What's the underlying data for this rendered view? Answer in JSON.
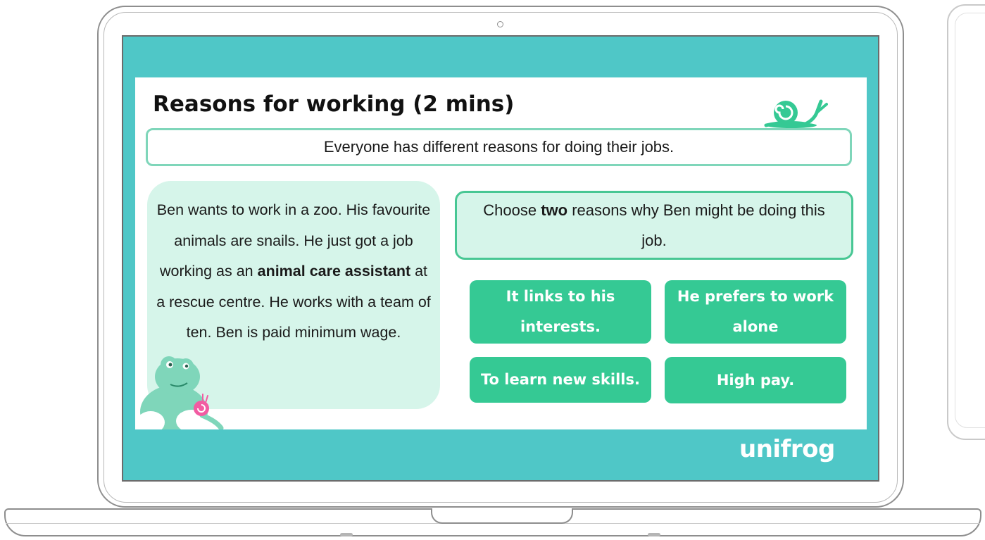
{
  "slide": {
    "title": "Reasons for working (2 mins)",
    "banner": "Everyone has different reasons for doing their jobs.",
    "story": {
      "part1": "Ben wants to work in a zoo. His favourite animals are snails. He just got a job working as an ",
      "bold": "animal care assistant",
      "part2": " at a rescue centre. He works with a team of ten. Ben is paid minimum wage."
    },
    "question": {
      "prefix": "Choose ",
      "bold": "two",
      "suffix": " reasons why Ben might be doing this job."
    },
    "options": [
      "It links to his interests.",
      "He prefers to work alone",
      "To learn new skills.",
      "High pay."
    ]
  },
  "brand": {
    "logo_text": "unifrog"
  },
  "colors": {
    "screen_bg": "#4fc7c7",
    "option_green": "#35c994",
    "story_bg": "#d6f5ea",
    "question_border": "#48c794",
    "banner_border": "#7fd6ba"
  },
  "icons": {
    "mascot_snail": "snail-icon",
    "mascot_frog": "frog-illustration"
  }
}
